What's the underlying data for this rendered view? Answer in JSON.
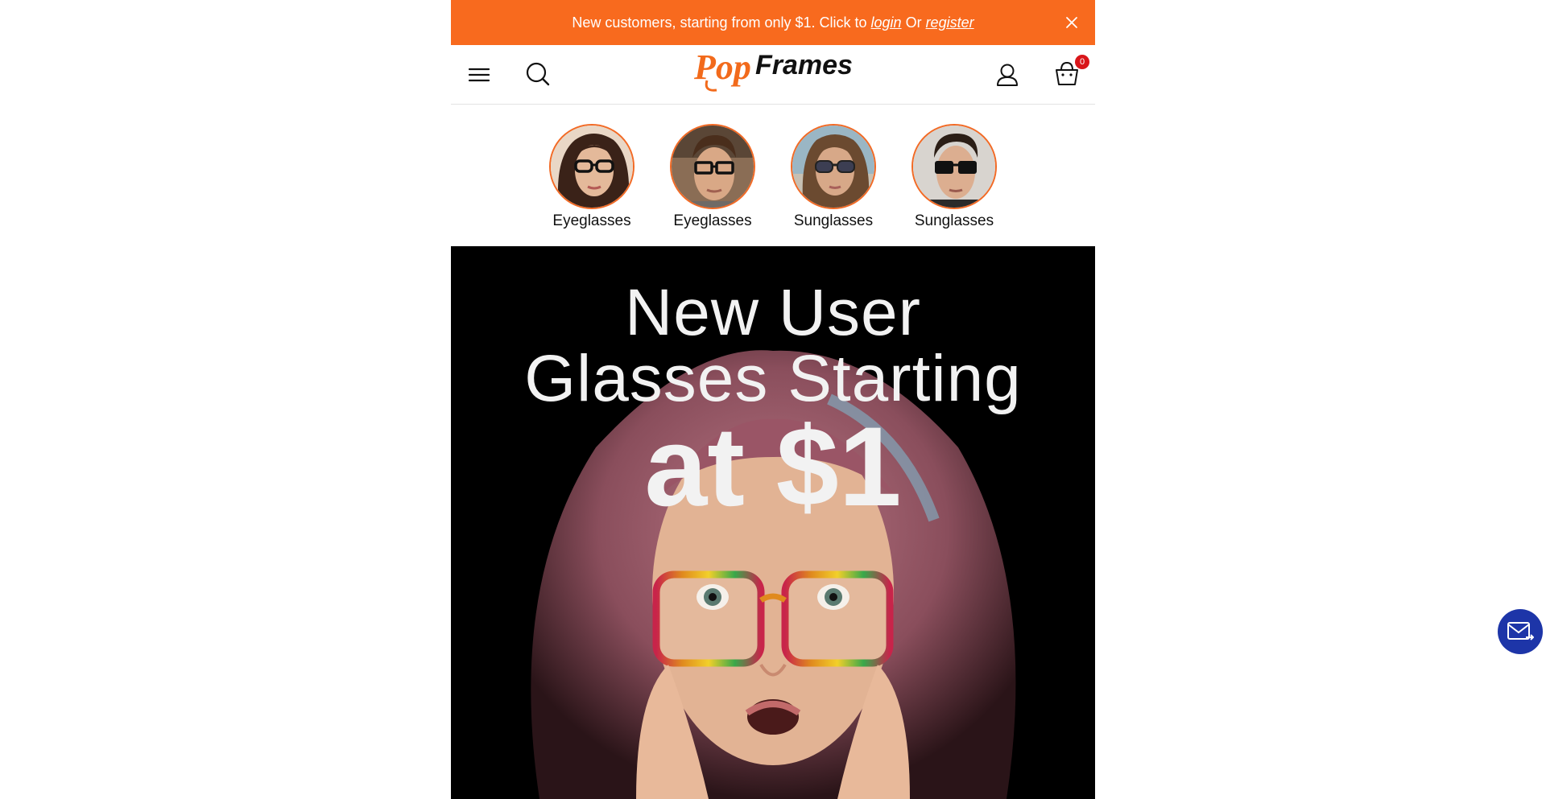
{
  "promo": {
    "text": "New customers, starting from only $1. Click to",
    "login_link": "login",
    "or_text": "Or",
    "register_link": "register",
    "background": "#f86a1e"
  },
  "header": {
    "logo_text_left": "Pop",
    "logo_text_right": "Frames",
    "cart_count": "0",
    "icons": [
      "menu-icon",
      "search-icon",
      "account-icon",
      "cart-icon"
    ]
  },
  "categories": [
    {
      "label": "Eyeglasses"
    },
    {
      "label": "Eyeglasses"
    },
    {
      "label": "Sunglasses"
    },
    {
      "label": "Sunglasses"
    }
  ],
  "hero": {
    "line1": "New User",
    "line2": "Glasses Starting",
    "line3": "at $1"
  },
  "floating": {
    "icon": "mail-icon",
    "color": "#1d35a8"
  }
}
